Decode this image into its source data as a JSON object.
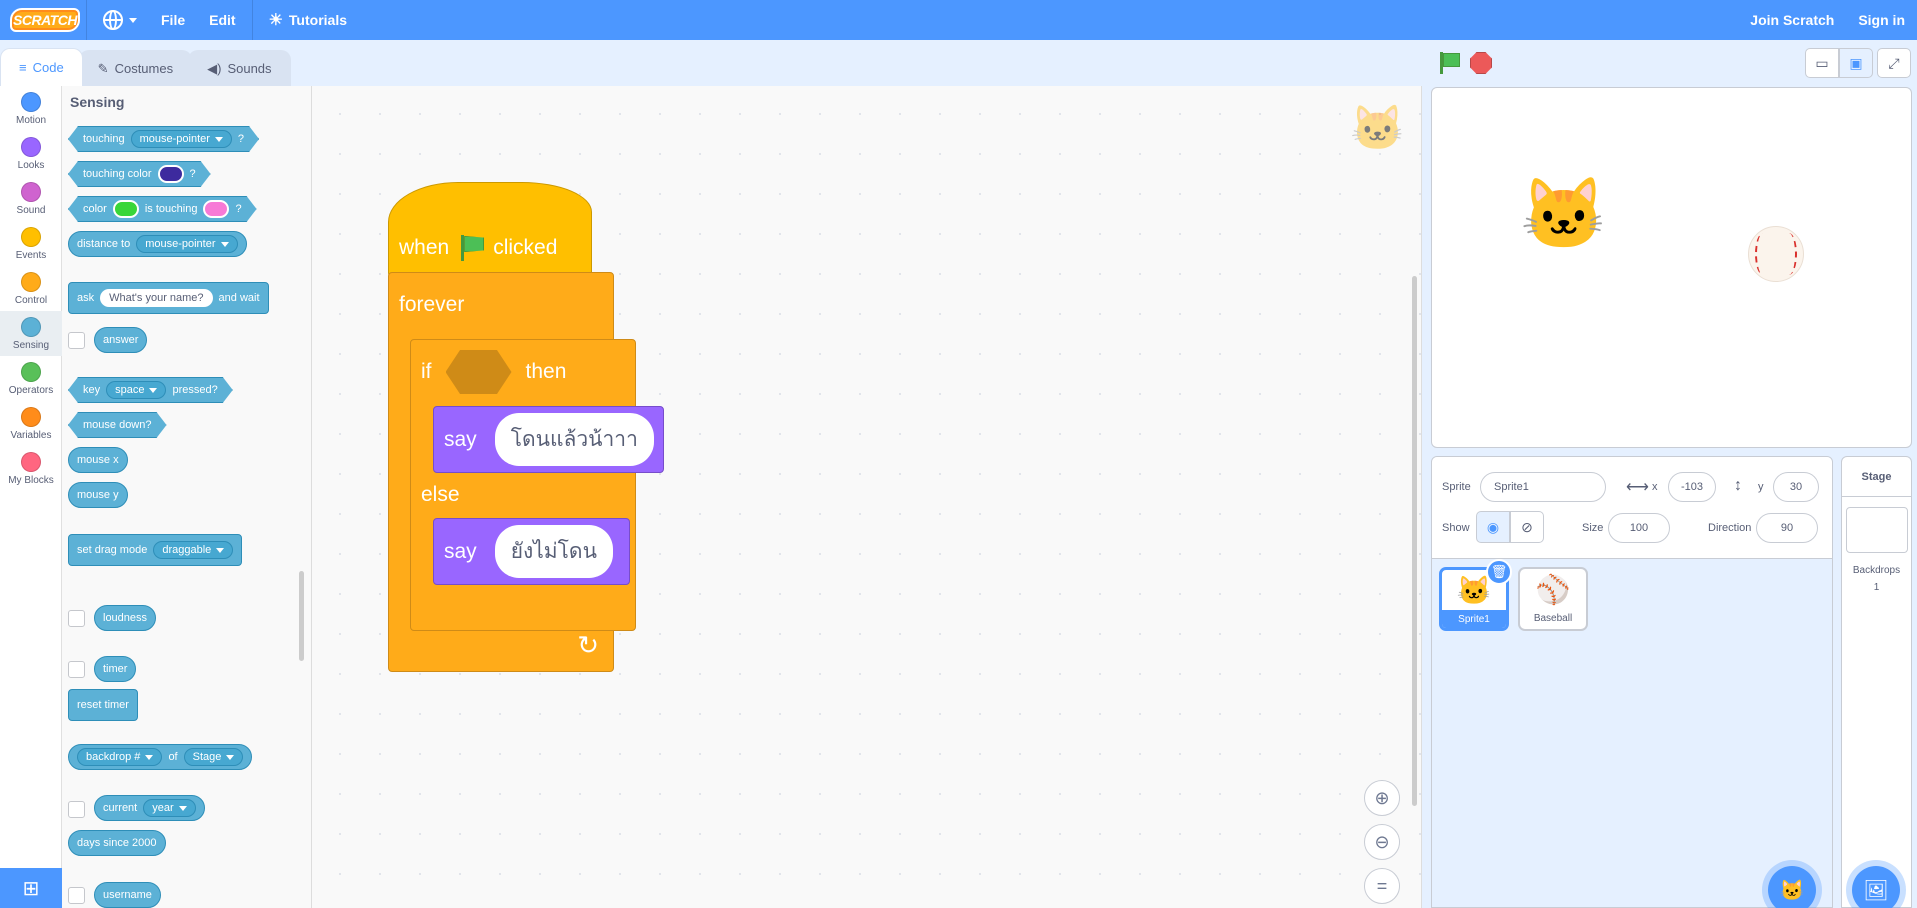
{
  "menu": {
    "logo": "SCRATCH",
    "file": "File",
    "edit": "Edit",
    "tutorials": "Tutorials",
    "join": "Join Scratch",
    "signin": "Sign in"
  },
  "tabs": {
    "code": "Code",
    "costumes": "Costumes",
    "sounds": "Sounds"
  },
  "categories": [
    {
      "label": "Motion",
      "color": "#4c97ff"
    },
    {
      "label": "Looks",
      "color": "#9966ff"
    },
    {
      "label": "Sound",
      "color": "#cf63cf"
    },
    {
      "label": "Events",
      "color": "#ffbf00"
    },
    {
      "label": "Control",
      "color": "#ffab19"
    },
    {
      "label": "Sensing",
      "color": "#5cb1d6"
    },
    {
      "label": "Operators",
      "color": "#59c059"
    },
    {
      "label": "Variables",
      "color": "#ff8c1a"
    },
    {
      "label": "My Blocks",
      "color": "#ff6680"
    }
  ],
  "palette": {
    "title": "Sensing",
    "touching": "touching",
    "touching_opt": "mouse-pointer",
    "q": "?",
    "touching_color": "touching color",
    "touching_color_value": "#3d2a9e",
    "color": "color",
    "color_a_value": "#39d639",
    "is_touching": "is touching",
    "color_b_value": "#f77ad6",
    "distance_to": "distance to",
    "distance_opt": "mouse-pointer",
    "ask": "ask",
    "ask_default": "What's your name?",
    "and_wait": "and wait",
    "answer": "answer",
    "key": "key",
    "key_opt": "space",
    "pressed": "pressed?",
    "mouse_down": "mouse down?",
    "mouse_x": "mouse x",
    "mouse_y": "mouse y",
    "set_drag_mode": "set drag mode",
    "drag_opt": "draggable",
    "loudness": "loudness",
    "timer": "timer",
    "reset_timer": "reset timer",
    "backdrop_opt": "backdrop #",
    "of": "of",
    "stage_opt": "Stage",
    "current": "current",
    "year_opt": "year",
    "days_since": "days since 2000",
    "username": "username"
  },
  "script": {
    "when": "when",
    "clicked": "clicked",
    "forever": "forever",
    "if": "if",
    "then": "then",
    "say1": "say",
    "say1_text": "โดนแล้วน้าาา",
    "else": "else",
    "say2": "say",
    "say2_text": "ยังไม่โดน"
  },
  "sprite_info": {
    "sprite_label": "Sprite",
    "sprite_name": "Sprite1",
    "x_label": "x",
    "x_value": "-103",
    "y_label": "y",
    "y_value": "30",
    "show_label": "Show",
    "size_label": "Size",
    "size_value": "100",
    "direction_label": "Direction",
    "direction_value": "90"
  },
  "sprites": [
    {
      "name": "Sprite1",
      "selected": true
    },
    {
      "name": "Baseball",
      "selected": false
    }
  ],
  "stage_pane": {
    "title": "Stage",
    "backdrops_label": "Backdrops",
    "backdrops_count": "1"
  }
}
